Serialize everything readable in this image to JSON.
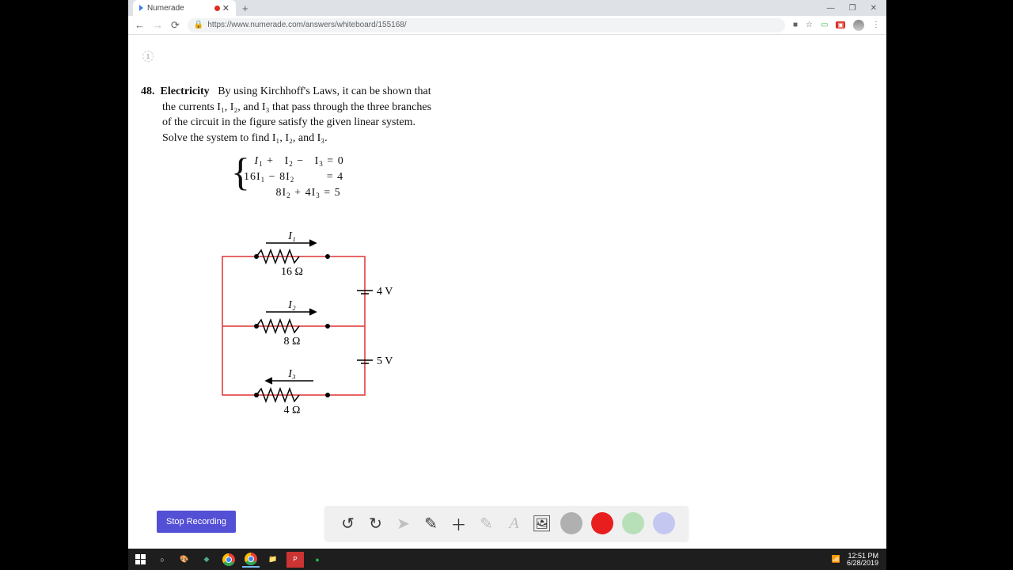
{
  "tab": {
    "title": "Numerade"
  },
  "window": {
    "min": "—",
    "max": "❐",
    "close": "✕"
  },
  "addr": {
    "url": "https://www.numerade.com/answers/whiteboard/155168/"
  },
  "page": {
    "num": "1"
  },
  "problem": {
    "number": "48.",
    "title": "Electricity",
    "text1": "By using Kirchhoff's Laws, it can be shown that",
    "text2": "the currents I₁, I₂, and I₃ that pass through the three branches",
    "text3": "of the circuit in the figure satisfy the given linear system.",
    "text4": "Solve the system to find I₁, I₂, and I₃."
  },
  "equations": {
    "eq1_l": "I",
    "eq1_m": " +   I",
    "eq1_r": " −   I",
    "eq1_e": " = 0",
    "eq2": "16I",
    "eq2_m": " − 8I",
    "eq2_e": "         = 4",
    "eq3": "         8I",
    "eq3_m": " + 4I",
    "eq3_e": " = 5"
  },
  "circuit": {
    "r1": "16 Ω",
    "r2": "8 Ω",
    "r3": "4 Ω",
    "v1": "4 V",
    "v2": "5 V",
    "i1": "I₁",
    "i2": "I₂",
    "i3": "I₃"
  },
  "buttons": {
    "stop": "Stop Recording"
  },
  "clock": {
    "time": "12:51 PM",
    "date": "6/28/2019"
  }
}
